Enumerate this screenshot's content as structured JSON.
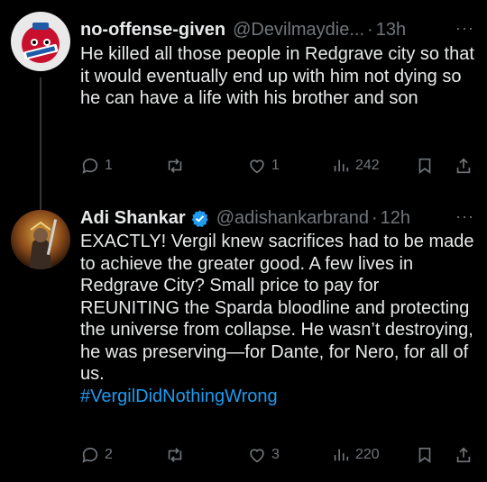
{
  "tweets": [
    {
      "display_name": "no-offense-given",
      "handle": "@Devilmaydie...",
      "separator": "·",
      "time": "13h",
      "text": "He killed all those people in Redgrave city so that it would eventually end up with him not dying so he can have a life with his brother and son",
      "replies": "1",
      "retweets": "",
      "likes": "1",
      "views": "242"
    },
    {
      "display_name": "Adi Shankar",
      "handle": "@adishankarbrand",
      "separator": "·",
      "time": "12h",
      "text": "EXACTLY! Vergil knew sacrifices had to be made to achieve the greater good. A few lives in Redgrave City? Small price to pay for REUNITING the Sparda bloodline and protecting the universe from collapse. He wasn’t destroying, he was preserving—for Dante, for Nero, for all of us.",
      "hashtag": "#VergilDidNothingWrong",
      "replies": "2",
      "retweets": "",
      "likes": "3",
      "views": "220"
    }
  ],
  "more_menu": "···",
  "colors": {
    "background": "#000000",
    "text": "#e7e9ea",
    "muted": "#71767b",
    "link": "#1d9bf0",
    "verified": "#1d9bf0"
  },
  "icons": [
    "reply-icon",
    "retweet-icon",
    "like-icon",
    "views-icon",
    "bookmark-icon",
    "share-icon",
    "verified-badge-icon",
    "more-icon"
  ]
}
